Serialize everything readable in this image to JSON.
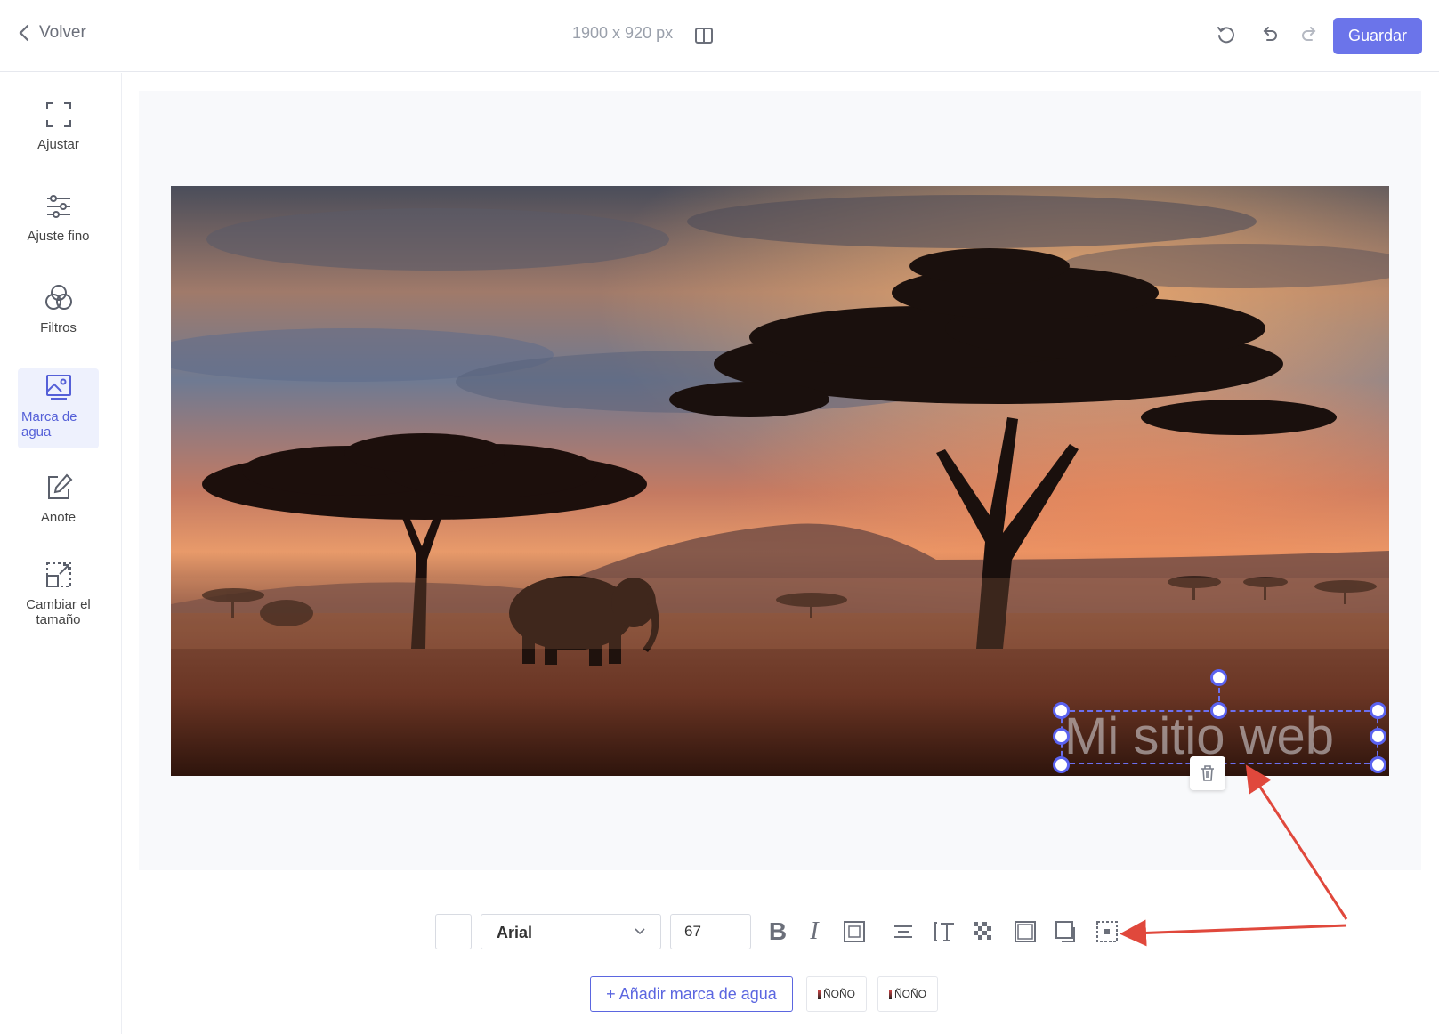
{
  "header": {
    "back_label": "Volver",
    "dimensions": "1900 x 920 px",
    "save_label": "Guardar"
  },
  "sidebar": {
    "items": [
      {
        "label": "Ajustar",
        "icon": "crop-frame-icon"
      },
      {
        "label": "Ajuste fino",
        "icon": "sliders-icon"
      },
      {
        "label": "Filtros",
        "icon": "filters-circles-icon"
      },
      {
        "label": "Marca de agua",
        "icon": "watermark-image-icon",
        "active": true
      },
      {
        "label": "Anote",
        "icon": "edit-pencil-icon"
      },
      {
        "label": "Cambiar el tamaño",
        "icon": "resize-icon"
      }
    ]
  },
  "canvas": {
    "watermark_text": "Mi sitio web"
  },
  "toolbar": {
    "font": "Arial",
    "font_size": "67",
    "bold_label": "B",
    "italic_label": "I"
  },
  "footer": {
    "add_watermark_label": "+ Añadir marca de agua",
    "presets": [
      {
        "label": "ÑOÑO"
      },
      {
        "label": "ÑOÑO"
      }
    ]
  },
  "colors": {
    "accent": "#6b74ea",
    "annotation_arrow": "#e0483c",
    "handle": "#5a62f0"
  }
}
